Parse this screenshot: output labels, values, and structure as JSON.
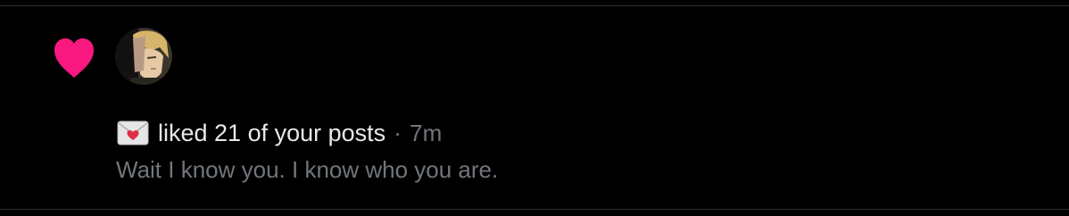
{
  "notification": {
    "type_icon": "heart-icon",
    "avatar_icon": "avatar",
    "emoji_icon": "envelope-with-heart-icon",
    "action_text": "liked 21 of your posts",
    "separator": "·",
    "time": "7m",
    "post_preview": "Wait I know you. I know who you are."
  },
  "colors": {
    "background": "#000000",
    "heart": "#f91880",
    "primary_text": "#e7e9ea",
    "secondary_text": "#71767b",
    "divider": "#2f3336"
  }
}
